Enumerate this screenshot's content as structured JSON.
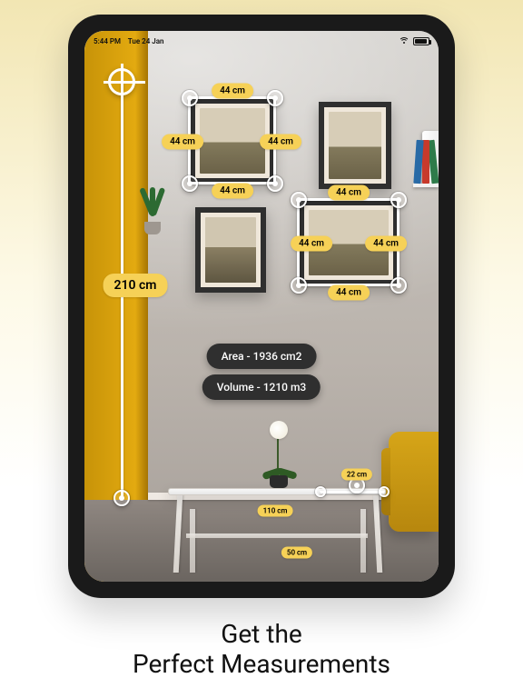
{
  "headline": {
    "line1": "Get the",
    "line2": "Perfect Measurements"
  },
  "statusbar": {
    "time": "5:44 PM",
    "date": "Tue 24 Jan"
  },
  "unit": "cm",
  "height_line": {
    "label": "210 cm"
  },
  "frame1": {
    "top": "44 cm",
    "bottom": "44 cm",
    "left": "44 cm",
    "right": "44 cm"
  },
  "frame4": {
    "top": "44 cm",
    "bottom": "44 cm",
    "left": "44 cm",
    "right": "44 cm"
  },
  "table": {
    "width": "110 cm",
    "depth": "50 cm",
    "side": "22 cm"
  },
  "info": {
    "area": "Area - 1936 cm2",
    "volume": "Volume - 1210 m3"
  }
}
